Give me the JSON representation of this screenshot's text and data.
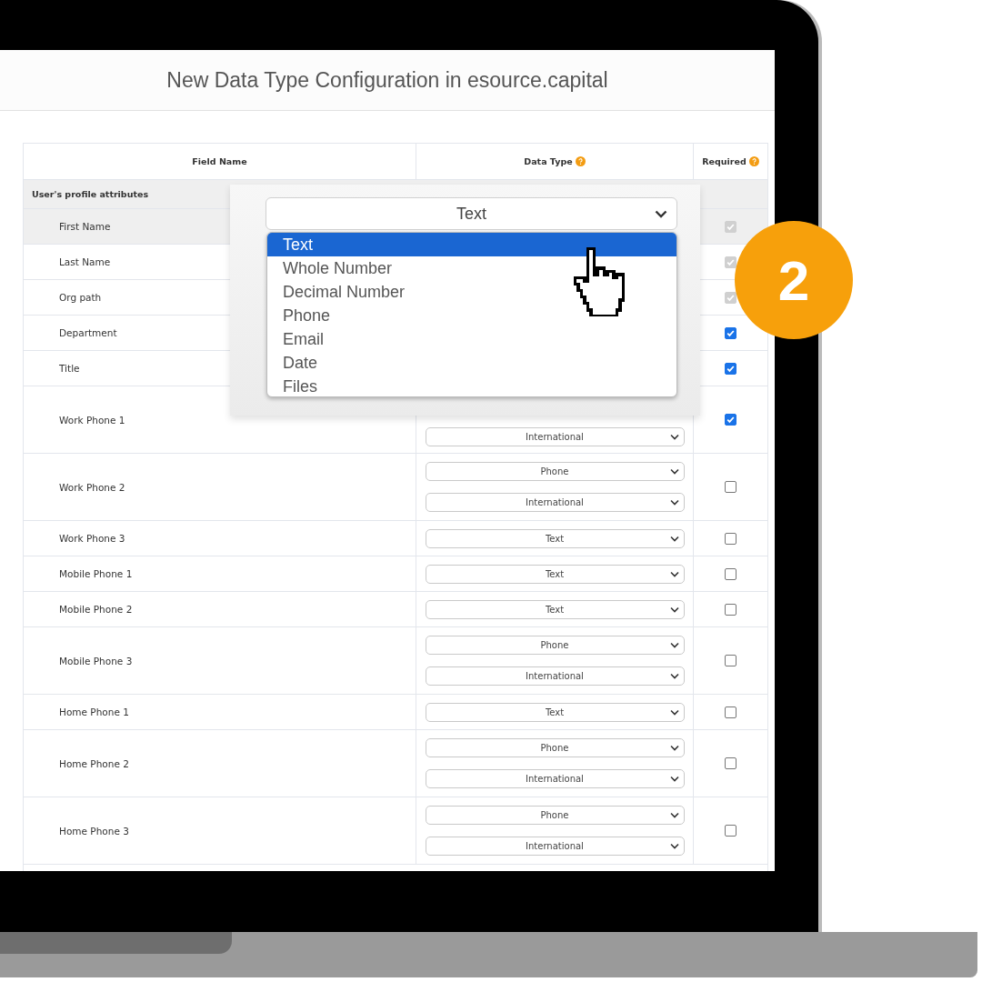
{
  "page": {
    "title": "New Data Type Configuration in esource.capital"
  },
  "table": {
    "columns": [
      {
        "label": "Field Name",
        "kind": "plain"
      },
      {
        "label": "Data Type",
        "kind": "help"
      },
      {
        "label": "Required",
        "kind": "help"
      }
    ],
    "section": "User's profile attributes",
    "rows": [
      {
        "name": "First Name",
        "kind": "single",
        "selected": true,
        "selects": [],
        "required": {
          "checked": true,
          "disabled": true
        }
      },
      {
        "name": "Last Name",
        "kind": "single",
        "selected": false,
        "selects": [],
        "required": {
          "checked": true,
          "disabled": true
        }
      },
      {
        "name": "Org path",
        "kind": "single",
        "selected": false,
        "selects": [],
        "required": {
          "checked": true,
          "disabled": true
        }
      },
      {
        "name": "Department",
        "kind": "single",
        "selected": false,
        "selects": [],
        "required": {
          "checked": true,
          "disabled": false
        }
      },
      {
        "name": "Title",
        "kind": "single",
        "selected": false,
        "selects": [],
        "required": {
          "checked": true,
          "disabled": false
        }
      },
      {
        "name": "Work Phone 1",
        "kind": "double",
        "selected": false,
        "selects": [
          "International"
        ],
        "required": {
          "checked": true,
          "disabled": false
        }
      },
      {
        "name": "Work Phone 2",
        "kind": "double",
        "selected": false,
        "selects": [
          "Phone",
          "International"
        ],
        "required": {
          "checked": false,
          "disabled": false
        }
      },
      {
        "name": "Work Phone 3",
        "kind": "single",
        "selected": false,
        "selects": [
          "Text"
        ],
        "required": {
          "checked": false,
          "disabled": false
        }
      },
      {
        "name": "Mobile Phone 1",
        "kind": "single",
        "selected": false,
        "selects": [
          "Text"
        ],
        "required": {
          "checked": false,
          "disabled": false
        }
      },
      {
        "name": "Mobile Phone 2",
        "kind": "single",
        "selected": false,
        "selects": [
          "Text"
        ],
        "required": {
          "checked": false,
          "disabled": false
        }
      },
      {
        "name": "Mobile Phone 3",
        "kind": "double",
        "selected": false,
        "selects": [
          "Phone",
          "International"
        ],
        "required": {
          "checked": false,
          "disabled": false
        }
      },
      {
        "name": "Home Phone 1",
        "kind": "single",
        "selected": false,
        "selects": [
          "Text"
        ],
        "required": {
          "checked": false,
          "disabled": false
        }
      },
      {
        "name": "Home Phone 2",
        "kind": "double",
        "selected": false,
        "selects": [
          "Phone",
          "International"
        ],
        "required": {
          "checked": false,
          "disabled": false
        }
      },
      {
        "name": "Home Phone 3",
        "kind": "double",
        "selected": false,
        "selects": [
          "Phone",
          "International"
        ],
        "required": {
          "checked": false,
          "disabled": false
        }
      }
    ]
  },
  "zoom_dropdown": {
    "value": "Text",
    "options": [
      {
        "label": "Text",
        "selected": true
      },
      {
        "label": "Whole Number",
        "selected": false
      },
      {
        "label": "Decimal Number",
        "selected": false
      },
      {
        "label": "Phone",
        "selected": false
      },
      {
        "label": "Email",
        "selected": false
      },
      {
        "label": "Date",
        "selected": false
      },
      {
        "label": "Files",
        "selected": false
      }
    ]
  },
  "step_badge": "2"
}
